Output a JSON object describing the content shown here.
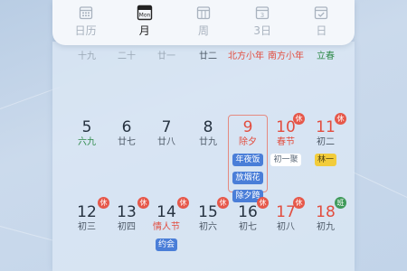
{
  "view_bar": {
    "tabs": [
      {
        "label": "日历",
        "icon": "calendar-grid-icon",
        "active": false
      },
      {
        "label": "月",
        "icon": "month-icon",
        "icon_text": "Mon",
        "active": true
      },
      {
        "label": "周",
        "icon": "week-icon",
        "active": false
      },
      {
        "label": "3日",
        "icon": "three-day-icon",
        "icon_text": "3",
        "active": false
      },
      {
        "label": "日",
        "icon": "day-check-icon",
        "active": false
      }
    ]
  },
  "row_prev": [
    {
      "lunar": "十九"
    },
    {
      "lunar": "二十"
    },
    {
      "lunar": "廿一"
    },
    {
      "lunar": "廿二"
    },
    {
      "lunar": "北方小年"
    },
    {
      "lunar": "南方小年"
    },
    {
      "lunar": "立春"
    }
  ],
  "row1": [
    {
      "day": "5",
      "lunar": "六九"
    },
    {
      "day": "6",
      "lunar": "廿七"
    },
    {
      "day": "7",
      "lunar": "廿八"
    },
    {
      "day": "8",
      "lunar": "廿九"
    },
    {
      "day": "9",
      "lunar": "除夕",
      "events": [
        "年夜饭",
        "放烟花",
        "除夕跨"
      ]
    },
    {
      "day": "10",
      "lunar": "春节",
      "badge": "休",
      "events": [
        "初一聚"
      ]
    },
    {
      "day": "11",
      "lunar": "初二",
      "badge": "休",
      "events": [
        "林一"
      ]
    }
  ],
  "row2": [
    {
      "day": "12",
      "lunar": "初三",
      "badge": "休"
    },
    {
      "day": "13",
      "lunar": "初四",
      "badge": "休"
    },
    {
      "day": "14",
      "lunar": "情人节",
      "badge": "休",
      "events": [
        "约会"
      ]
    },
    {
      "day": "15",
      "lunar": "初六",
      "badge": "休"
    },
    {
      "day": "16",
      "lunar": "初七",
      "badge": "休"
    },
    {
      "day": "17",
      "lunar": "初八",
      "badge": "休"
    },
    {
      "day": "18",
      "lunar": "初九",
      "badge": "班"
    }
  ],
  "colors": {
    "holiday_red": "#e24d3f",
    "event_blue": "#4a7ed8",
    "event_yellow": "#f2cc3b",
    "work_green": "#3f9a5a"
  }
}
